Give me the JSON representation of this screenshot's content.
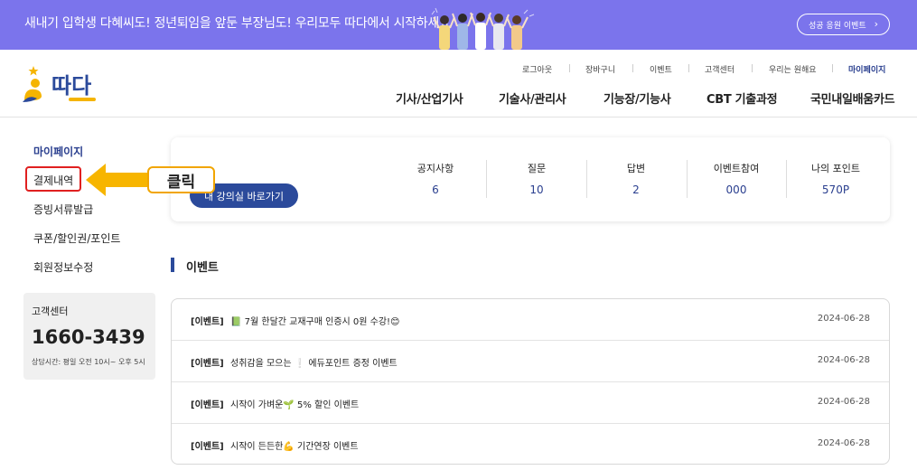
{
  "banner": {
    "text": "새내기 입학생 다혜씨도! 정년퇴임을 앞둔 부장님도! 우리모두 따다에서 시작하세요",
    "button_label": "성공 응원 이벤트",
    "button_chevron": "›"
  },
  "logo": {
    "text": "따다"
  },
  "util_nav": [
    {
      "label": "로그아웃"
    },
    {
      "label": "장바구니"
    },
    {
      "label": "이벤트"
    },
    {
      "label": "고객센터"
    },
    {
      "label": "우리는 원해요"
    },
    {
      "label": "마이페이지"
    }
  ],
  "gnb": [
    {
      "label": "기사/산업기사"
    },
    {
      "label": "기술사/관리사"
    },
    {
      "label": "기능장/기능사"
    },
    {
      "label": "CBT 기출과정"
    },
    {
      "label": "국민내일배움카드"
    }
  ],
  "sidebar": {
    "title": "마이페이지",
    "items": [
      {
        "label": "결제내역"
      },
      {
        "label": "증빙서류발급"
      },
      {
        "label": "쿠폰/할인권/포인트"
      },
      {
        "label": "회원정보수정"
      }
    ]
  },
  "customer_center": {
    "title": "고객센터",
    "phone": "1660-3439",
    "hours": "상담시간: 평일 오전 10시~ 오후 5시"
  },
  "classroom_button": "내 강의실 바로가기",
  "stats": [
    {
      "label": "공지사항",
      "value": "6"
    },
    {
      "label": "질문",
      "value": "10"
    },
    {
      "label": "답변",
      "value": "2"
    },
    {
      "label": "이벤트참여",
      "value": "000"
    },
    {
      "label": "나의 포인트",
      "value": "570P"
    }
  ],
  "callout": {
    "text": "클릭"
  },
  "events": {
    "title": "이벤트",
    "items": [
      {
        "tag": "[이벤트]",
        "title": "📗 7월 한달간 교재구매 인증시 0원 수강!😊",
        "date": "2024-06-28"
      },
      {
        "tag": "[이벤트]",
        "title": "성취감을 모으는 ❕ 에듀포인트 증정 이벤트",
        "date": "2024-06-28"
      },
      {
        "tag": "[이벤트]",
        "title": "시작이 가벼운🌱 5% 할인 이벤트",
        "date": "2024-06-28"
      },
      {
        "tag": "[이벤트]",
        "title": "시작이 든든한💪 기간연장 이벤트",
        "date": "2024-06-28"
      }
    ]
  },
  "colors": {
    "banner_bg": "#7b74ec",
    "brand_navy": "#2b4a9b",
    "highlight_red": "#e02020",
    "callout_orange": "#f1a500",
    "arrow_yellow": "#f7b500"
  }
}
